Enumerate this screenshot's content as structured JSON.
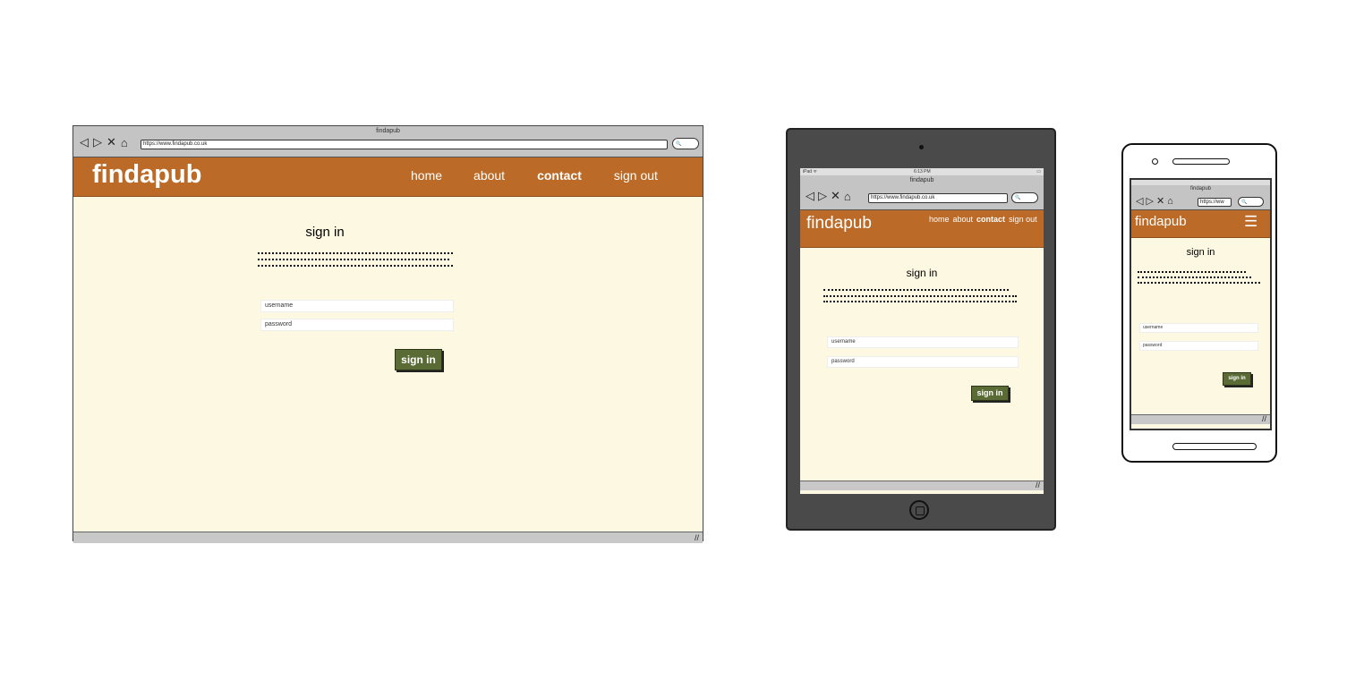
{
  "desktop": {
    "window_title": "findapub",
    "url": "https://www.findapub.co.uk",
    "nav_icons": {
      "back": "◁",
      "forward": "▷",
      "stop": "✕",
      "home": "⌂"
    },
    "search_icon": "🔍",
    "brand": "findapub",
    "nav_links": [
      "home",
      "about",
      "contact",
      "sign out"
    ],
    "heading": "sign in",
    "username_placeholder": "username",
    "password_placeholder": "password",
    "button": "sign in",
    "resize_grip": "//"
  },
  "tablet": {
    "status_left": "iPad ᯤ",
    "status_time": "6:13 PM",
    "status_battery": "▭",
    "window_title": "findapub",
    "url": "https://www.findapub.co.uk",
    "brand": "findapub",
    "nav_links": [
      "home",
      "about",
      "contact",
      "sign out"
    ],
    "heading": "sign in",
    "username_placeholder": "username",
    "password_placeholder": "password",
    "button": "sign in",
    "resize_grip": "//"
  },
  "phone": {
    "window_title": "findapub",
    "url": "https://ww",
    "brand": "findapub",
    "menu_icon": "☰",
    "heading": "sign in",
    "username_placeholder": "username",
    "password_placeholder": "password",
    "button": "sign in",
    "resize_grip": "//"
  },
  "colors": {
    "navbar": "#bb6a27",
    "page_background": "#fdf8e1",
    "button": "#5a6b35",
    "device_frame": "#4a4a4a"
  }
}
